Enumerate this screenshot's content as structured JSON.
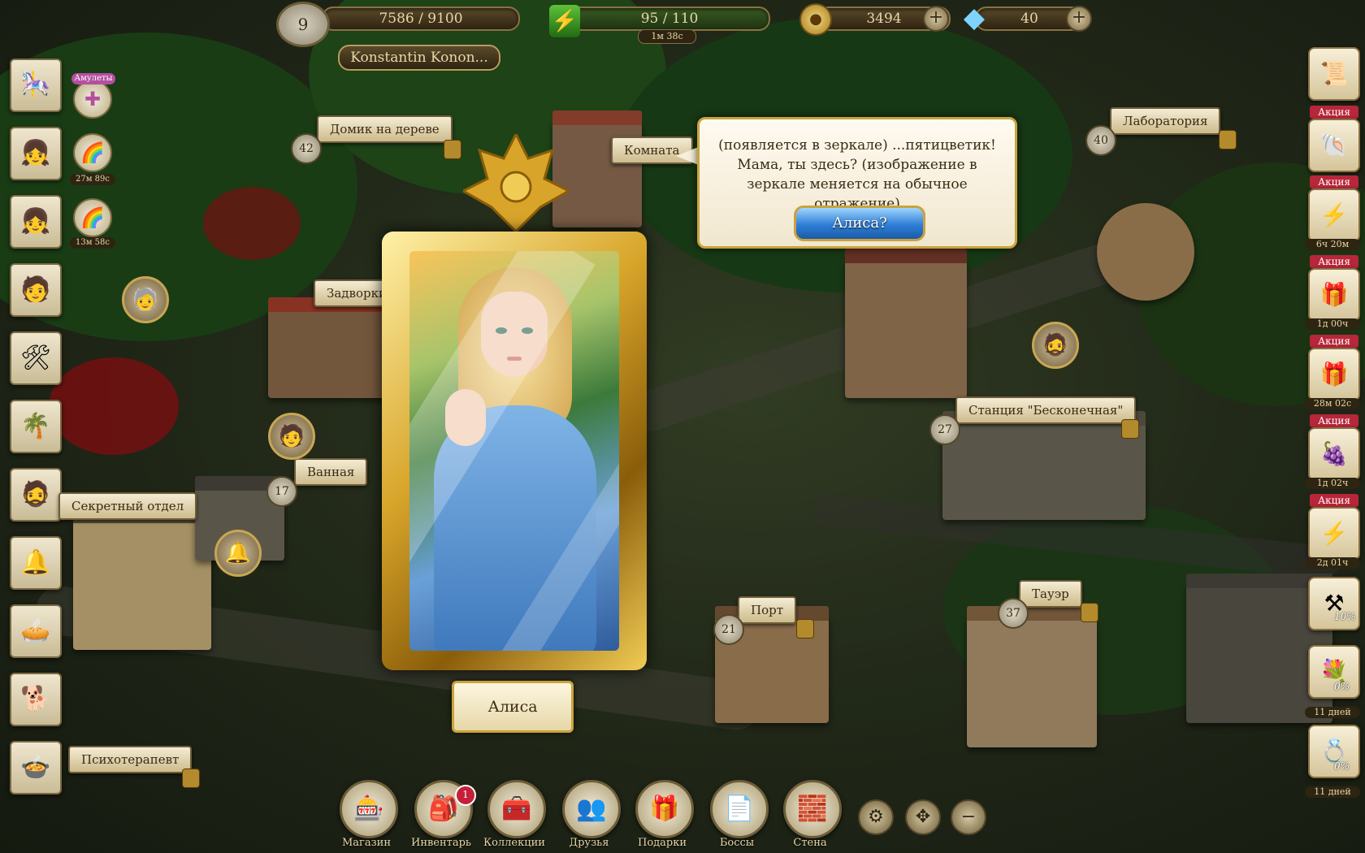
{
  "topbar": {
    "level": "9",
    "xp": "7586 / 9100",
    "energy": "95 / 110",
    "energy_timer": "1м 38с",
    "coins": "3494",
    "gems": "40",
    "player_name": "Konstantin  Konon..."
  },
  "left_sidebar": {
    "amulets_label": "Амулеты",
    "timer1": "27м 89с",
    "timer2": "13м 58с"
  },
  "map_labels": {
    "treehouse": "Домик на дереве",
    "room": "Комната",
    "backyard": "Задворки",
    "bathroom": "Ванная",
    "secret_dept": "Секретный отдел",
    "psychotherapist": "Психотерапевт",
    "laboratory": "Лаборатория",
    "station": "Станция \"Бесконечная\"",
    "port": "Порт",
    "tower": "Тауэр"
  },
  "location_levels": {
    "treehouse": "42",
    "laboratory": "40",
    "station": "27",
    "bathroom": "17",
    "port": "21",
    "tower": "37"
  },
  "dialog": {
    "text": "(появляется в зеркале) ...пятицветик! Мама, ты здесь? (изображение в зеркале меняется на обычное отражение)",
    "button": "Алиса?",
    "character_name": "Алиса"
  },
  "right_sidebar": {
    "promo_label": "Акция",
    "timers": [
      "6ч 20м",
      "1д 00ч",
      "28м 02с",
      "1д 02ч",
      "2д 01ч",
      "11 дней",
      "11 дней"
    ],
    "percent1": "10%",
    "percent2": "0%",
    "percent3": "0%"
  },
  "bottom_nav": [
    {
      "label": "Магазин",
      "icon": "shop-icon"
    },
    {
      "label": "Инвентарь",
      "icon": "inventory-icon"
    },
    {
      "label": "Коллекции",
      "icon": "collections-icon"
    },
    {
      "label": "Друзья",
      "icon": "friends-icon"
    },
    {
      "label": "Подарки",
      "icon": "gifts-icon"
    },
    {
      "label": "Боссы",
      "icon": "bosses-icon"
    },
    {
      "label": "Стена",
      "icon": "wall-icon"
    }
  ],
  "notification_count": "1",
  "colors": {
    "gold": "#c9a33c",
    "parchment": "#f4ecd4",
    "button_blue": "#2e7fd6",
    "promo_red": "#b8263a"
  }
}
